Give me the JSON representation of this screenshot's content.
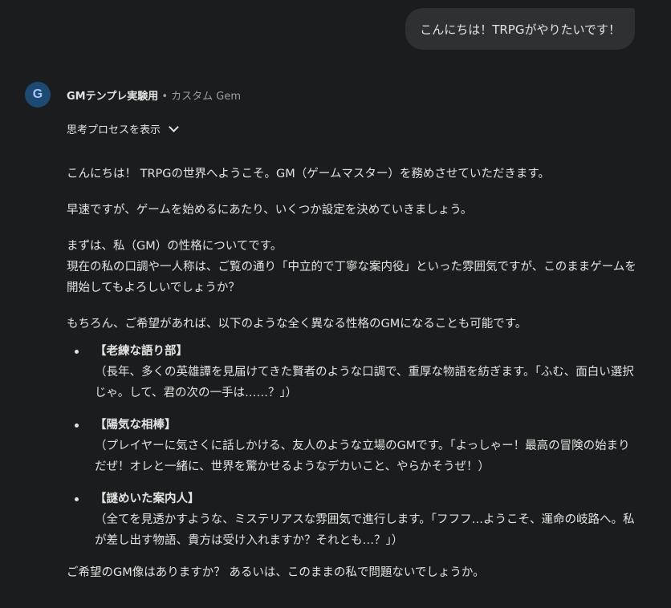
{
  "user_message": "こんにちは！TRPGがやりたいです！",
  "gem": {
    "avatar_letter": "G",
    "name": "GMテンプレ実験用",
    "separator": "•",
    "type": "カスタム Gem"
  },
  "thinking_toggle": {
    "label": "思考プロセスを表示",
    "icon": "chevron-down-icon"
  },
  "response": {
    "paragraph1": "こんにちは！ TRPGの世界へようこそ。GM（ゲームマスター）を務めさせていただきます。",
    "paragraph2": "早速ですが、ゲームを始めるにあたり、いくつか設定を決めていきましょう。",
    "paragraph3_line1": "まずは、私（GM）の性格についてです。",
    "paragraph3_line2": "現在の私の口調や一人称は、ご覧の通り「中立的で丁寧な案内役」といった雰囲気ですが、このままゲームを開始してもよろしいでしょうか？",
    "paragraph4": "もちろん、ご希望があれば、以下のような全く異なる性格のGMになることも可能です。",
    "options": [
      {
        "title": "【老練な語り部】",
        "description": "（長年、多くの英雄譚を見届けてきた賢者のような口調で、重厚な物語を紡ぎます。「ふむ、面白い選択じゃ。して、君の次の一手は……？」）"
      },
      {
        "title": "【陽気な相棒】",
        "description": "（プレイヤーに気さくに話しかける、友人のような立場のGMです。「よっしゃー！最高の冒険の始まりだぜ！オレと一緒に、世界を驚かせるようなデカいこと、やらかそうぜ！）"
      },
      {
        "title": "【謎めいた案内人】",
        "description": "（全てを見透かすような、ミステリアスな雰囲気で進行します。「フフフ…ようこそ、運命の岐路へ。私が差し出す物語、貴方は受け入れますか？それとも…？」）"
      }
    ],
    "paragraph5": "ご希望のGM像はありますか？ あるいは、このままの私で問題ないでしょうか。"
  },
  "colors": {
    "background": "#1b1c1d",
    "user_bubble": "#2f3032",
    "text": "#e3e3e3",
    "muted_text": "#9aa0a6",
    "avatar_bg": "#1c4a72",
    "avatar_letter": "#a8c7fa"
  }
}
